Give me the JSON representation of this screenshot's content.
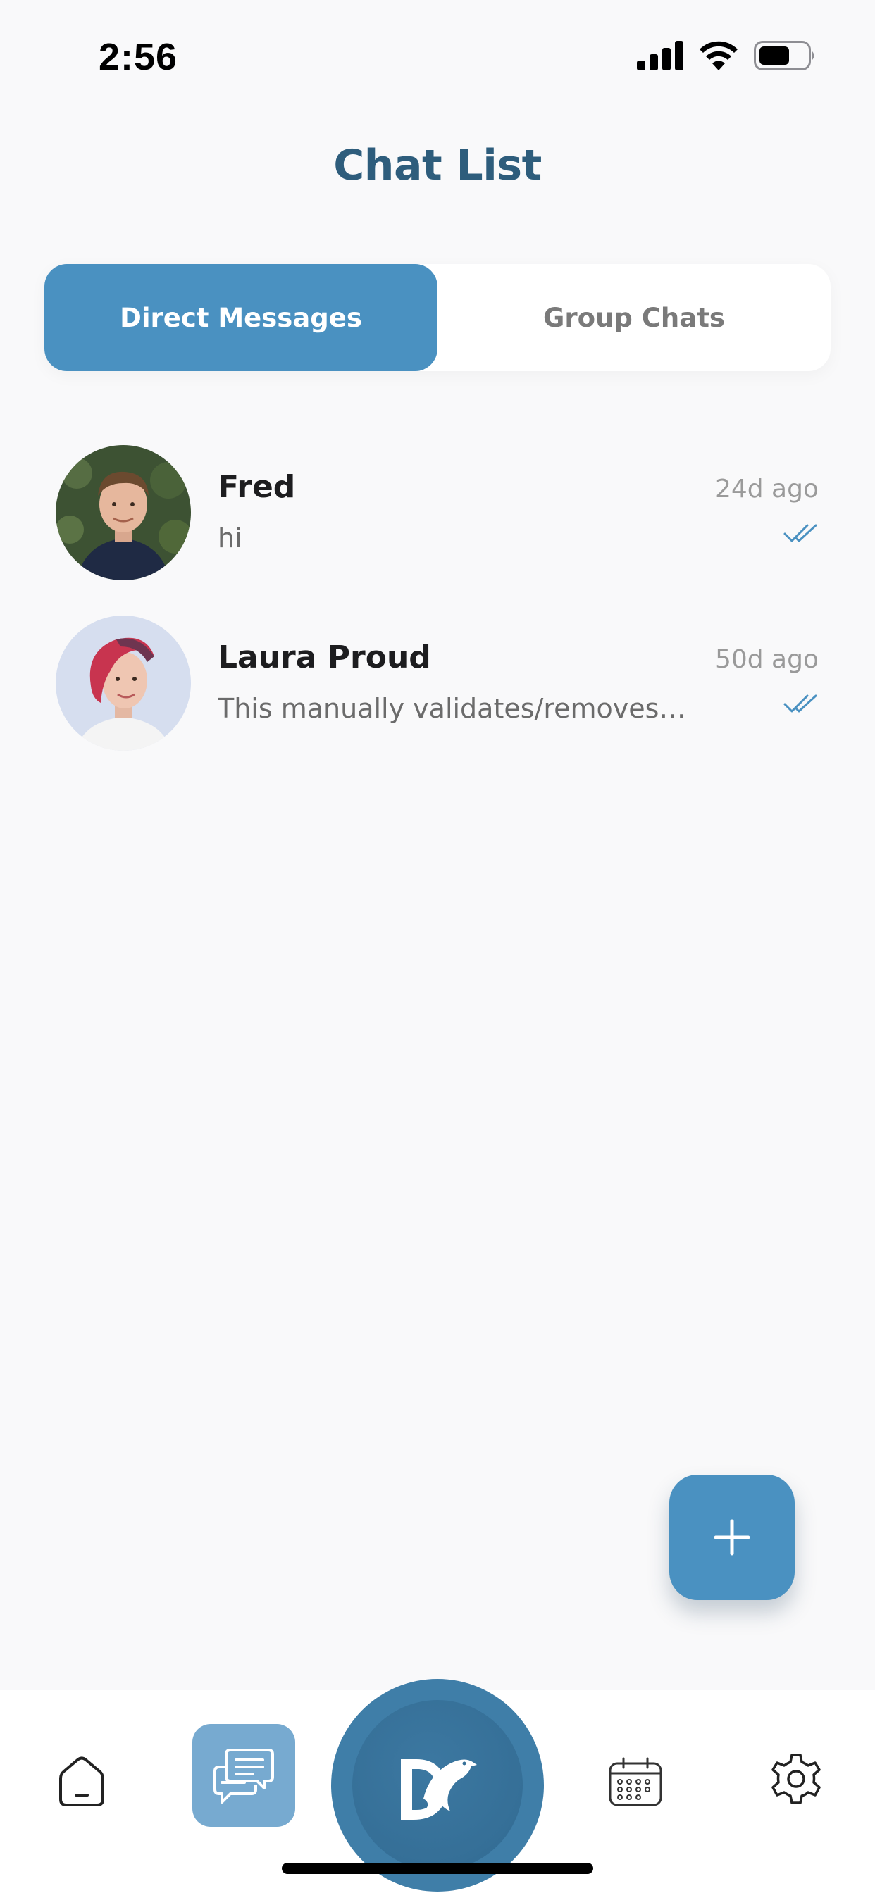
{
  "status_bar": {
    "time": "2:56"
  },
  "header": {
    "title": "Chat List"
  },
  "tabs": [
    {
      "label": "Direct Messages",
      "active": true
    },
    {
      "label": "Group Chats",
      "active": false
    }
  ],
  "chats": [
    {
      "name": "Fred",
      "preview": "hi",
      "time": "24d ago",
      "read": true
    },
    {
      "name": "Laura Proud",
      "preview": "This manually validates/removes…",
      "time": "50d ago",
      "read": true
    }
  ],
  "fab": {
    "icon": "plus-icon"
  },
  "nav": {
    "items": [
      {
        "icon": "home-icon",
        "active": false
      },
      {
        "icon": "chat-bubbles-icon",
        "active": true
      },
      {
        "icon": "dolphin-logo-icon",
        "active": false
      },
      {
        "icon": "calendar-icon",
        "active": false
      },
      {
        "icon": "gear-icon",
        "active": false
      }
    ]
  },
  "colors": {
    "accent": "#4a91c1",
    "title": "#2e5d7c",
    "background": "#f9f9fa",
    "read_check": "#4a91c1"
  }
}
